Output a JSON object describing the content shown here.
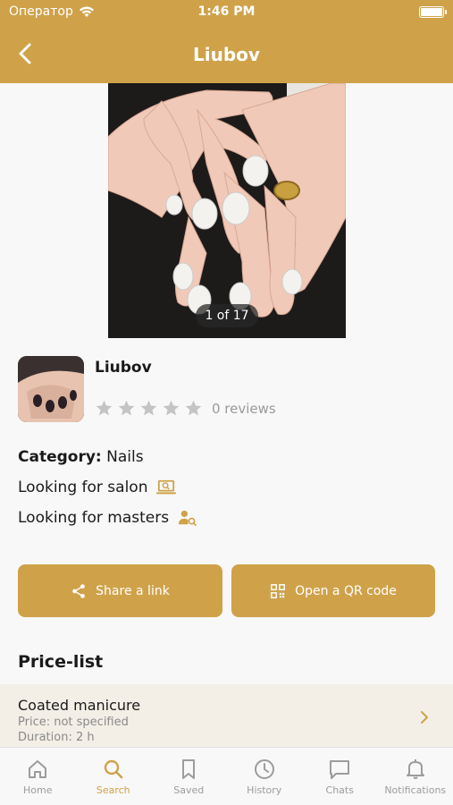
{
  "status_bar": {
    "carrier": "Оператор",
    "time": "1:46 PM"
  },
  "nav": {
    "title": "Liubov"
  },
  "gallery": {
    "counter": "1 of 17"
  },
  "profile": {
    "name": "Liubov",
    "rating": 0,
    "reviews": "0 reviews"
  },
  "info": {
    "category_label": "Category:",
    "category_value": "Nails",
    "salon": "Looking for salon",
    "masters": "Looking for masters"
  },
  "actions": {
    "share": "Share a link",
    "qr": "Open a QR code"
  },
  "price_list": {
    "title": "Price-list",
    "items": [
      {
        "name": "Coated manicure",
        "price": "Price: not specified",
        "duration": "Duration: 2 h"
      }
    ]
  },
  "tabs": [
    {
      "label": "Home",
      "icon": "home-icon"
    },
    {
      "label": "Search",
      "icon": "search-icon"
    },
    {
      "label": "Saved",
      "icon": "bookmark-icon"
    },
    {
      "label": "History",
      "icon": "clock-icon"
    },
    {
      "label": "Chats",
      "icon": "chat-icon"
    },
    {
      "label": "Notifications",
      "icon": "bell-icon"
    }
  ],
  "colors": {
    "accent": "#cfa24a",
    "star_empty": "#c4c4c4",
    "tab_inactive": "#9c9c9c"
  }
}
